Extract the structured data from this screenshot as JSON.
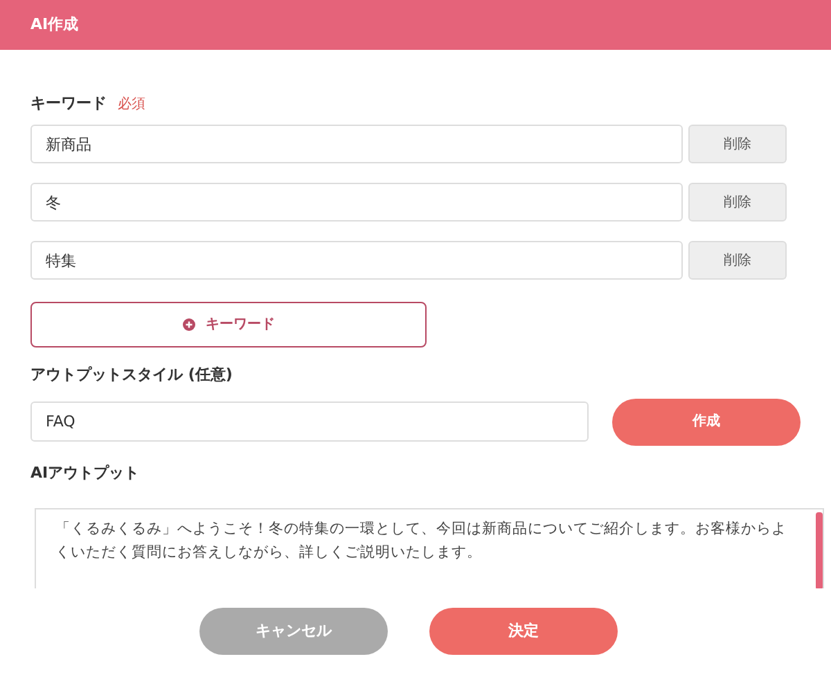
{
  "header": {
    "title": "AI作成"
  },
  "keywords": {
    "label": "キーワード",
    "required_badge": "必須",
    "items": [
      {
        "value": "新商品",
        "delete": "削除"
      },
      {
        "value": "冬",
        "delete": "削除"
      },
      {
        "value": "特集",
        "delete": "削除"
      }
    ],
    "add_button": "キーワード"
  },
  "output_style": {
    "label": "アウトプットスタイル (任意)",
    "value": "FAQ",
    "create_button": "作成"
  },
  "ai_output": {
    "label": "AIアウトプット",
    "text": "「くるみくるみ」へようこそ！冬の特集の一環として、今回は新商品についてご紹介します。お客様からよくいただく質問にお答えしながら、詳しくご説明いたします。"
  },
  "footer": {
    "cancel": "キャンセル",
    "confirm": "決定"
  }
}
